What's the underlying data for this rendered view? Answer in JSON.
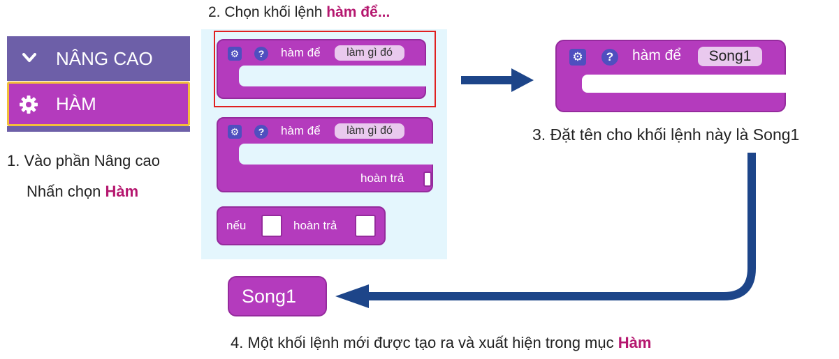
{
  "sidebar": {
    "advanced_label": "NÂNG CAO",
    "functions_label": "HÀM"
  },
  "step1": {
    "line1": "1. Vào phần Nâng cao",
    "line2_prefix": "Nhấn chọn ",
    "line2_highlight": "Hàm"
  },
  "step2": {
    "prefix": "2. Chọn khối lệnh ",
    "highlight": "hàm để..."
  },
  "palette": {
    "block1": {
      "label": "hàm để",
      "name": "làm gì đó"
    },
    "block2": {
      "label": "hàm để",
      "name": "làm gì đó",
      "return_label": "hoàn trả"
    },
    "block3": {
      "if_label": "nếu",
      "return_label": "hoàn trả"
    }
  },
  "step3": {
    "block": {
      "label": "hàm để",
      "name": "Song1"
    },
    "caption": "3. Đặt tên cho khối lệnh này là Song1"
  },
  "step4": {
    "block_label": "Song1",
    "caption_prefix": "4. Một khối lệnh mới được tạo ra và xuất hiện trong mục ",
    "caption_highlight": "Hàm"
  },
  "colors": {
    "block_purple": "#b43bbd",
    "category_violet": "#6d5fa8",
    "arrow_blue": "#1d4589",
    "highlight_red": "#e02020",
    "highlight_text": "#b5176f",
    "palette_bg": "#e4f6fd"
  },
  "icons": [
    "chevron-down-icon",
    "gear-icon",
    "help-icon",
    "arrow-right",
    "arrow-left"
  ]
}
